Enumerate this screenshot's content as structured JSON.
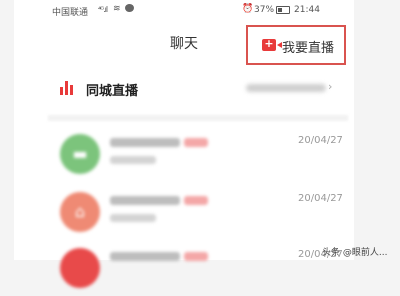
{
  "status_bar": {
    "carrier": "中国联通",
    "signal": "⁴ᴳ.ıl",
    "battery_percent": "37%",
    "time": "21:44"
  },
  "header": {
    "title": "聊天",
    "go_live_label": "我要直播",
    "accent_color": "#e83a3a"
  },
  "section": {
    "title": "同城直播"
  },
  "list": {
    "items": [
      {
        "date": "20/04/27",
        "avatar_color": "#7cc47c",
        "avatar_icon": "chat-icon"
      },
      {
        "date": "20/04/27",
        "avatar_color": "#ef8a74",
        "avatar_icon": "home-icon"
      },
      {
        "date": "20/04/27",
        "avatar_color": "#e84a4a",
        "avatar_icon": ""
      }
    ]
  },
  "watermark": "头条 @眼前人..."
}
